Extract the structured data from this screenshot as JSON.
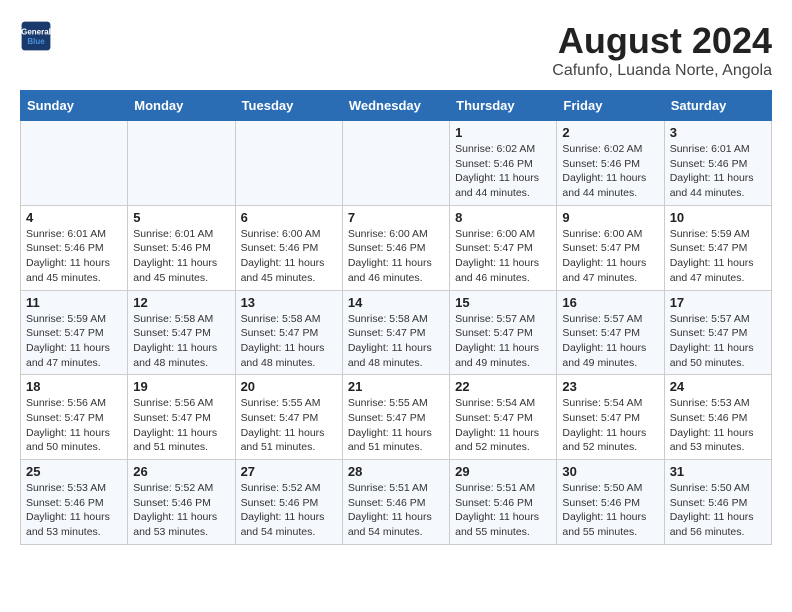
{
  "header": {
    "logo_line1": "General",
    "logo_line2": "Blue",
    "title": "August 2024",
    "subtitle": "Cafunfo, Luanda Norte, Angola"
  },
  "days_of_week": [
    "Sunday",
    "Monday",
    "Tuesday",
    "Wednesday",
    "Thursday",
    "Friday",
    "Saturday"
  ],
  "weeks": [
    [
      {
        "day": "",
        "detail": ""
      },
      {
        "day": "",
        "detail": ""
      },
      {
        "day": "",
        "detail": ""
      },
      {
        "day": "",
        "detail": ""
      },
      {
        "day": "1",
        "detail": "Sunrise: 6:02 AM\nSunset: 5:46 PM\nDaylight: 11 hours\nand 44 minutes."
      },
      {
        "day": "2",
        "detail": "Sunrise: 6:02 AM\nSunset: 5:46 PM\nDaylight: 11 hours\nand 44 minutes."
      },
      {
        "day": "3",
        "detail": "Sunrise: 6:01 AM\nSunset: 5:46 PM\nDaylight: 11 hours\nand 44 minutes."
      }
    ],
    [
      {
        "day": "4",
        "detail": "Sunrise: 6:01 AM\nSunset: 5:46 PM\nDaylight: 11 hours\nand 45 minutes."
      },
      {
        "day": "5",
        "detail": "Sunrise: 6:01 AM\nSunset: 5:46 PM\nDaylight: 11 hours\nand 45 minutes."
      },
      {
        "day": "6",
        "detail": "Sunrise: 6:00 AM\nSunset: 5:46 PM\nDaylight: 11 hours\nand 45 minutes."
      },
      {
        "day": "7",
        "detail": "Sunrise: 6:00 AM\nSunset: 5:46 PM\nDaylight: 11 hours\nand 46 minutes."
      },
      {
        "day": "8",
        "detail": "Sunrise: 6:00 AM\nSunset: 5:47 PM\nDaylight: 11 hours\nand 46 minutes."
      },
      {
        "day": "9",
        "detail": "Sunrise: 6:00 AM\nSunset: 5:47 PM\nDaylight: 11 hours\nand 47 minutes."
      },
      {
        "day": "10",
        "detail": "Sunrise: 5:59 AM\nSunset: 5:47 PM\nDaylight: 11 hours\nand 47 minutes."
      }
    ],
    [
      {
        "day": "11",
        "detail": "Sunrise: 5:59 AM\nSunset: 5:47 PM\nDaylight: 11 hours\nand 47 minutes."
      },
      {
        "day": "12",
        "detail": "Sunrise: 5:58 AM\nSunset: 5:47 PM\nDaylight: 11 hours\nand 48 minutes."
      },
      {
        "day": "13",
        "detail": "Sunrise: 5:58 AM\nSunset: 5:47 PM\nDaylight: 11 hours\nand 48 minutes."
      },
      {
        "day": "14",
        "detail": "Sunrise: 5:58 AM\nSunset: 5:47 PM\nDaylight: 11 hours\nand 48 minutes."
      },
      {
        "day": "15",
        "detail": "Sunrise: 5:57 AM\nSunset: 5:47 PM\nDaylight: 11 hours\nand 49 minutes."
      },
      {
        "day": "16",
        "detail": "Sunrise: 5:57 AM\nSunset: 5:47 PM\nDaylight: 11 hours\nand 49 minutes."
      },
      {
        "day": "17",
        "detail": "Sunrise: 5:57 AM\nSunset: 5:47 PM\nDaylight: 11 hours\nand 50 minutes."
      }
    ],
    [
      {
        "day": "18",
        "detail": "Sunrise: 5:56 AM\nSunset: 5:47 PM\nDaylight: 11 hours\nand 50 minutes."
      },
      {
        "day": "19",
        "detail": "Sunrise: 5:56 AM\nSunset: 5:47 PM\nDaylight: 11 hours\nand 51 minutes."
      },
      {
        "day": "20",
        "detail": "Sunrise: 5:55 AM\nSunset: 5:47 PM\nDaylight: 11 hours\nand 51 minutes."
      },
      {
        "day": "21",
        "detail": "Sunrise: 5:55 AM\nSunset: 5:47 PM\nDaylight: 11 hours\nand 51 minutes."
      },
      {
        "day": "22",
        "detail": "Sunrise: 5:54 AM\nSunset: 5:47 PM\nDaylight: 11 hours\nand 52 minutes."
      },
      {
        "day": "23",
        "detail": "Sunrise: 5:54 AM\nSunset: 5:47 PM\nDaylight: 11 hours\nand 52 minutes."
      },
      {
        "day": "24",
        "detail": "Sunrise: 5:53 AM\nSunset: 5:46 PM\nDaylight: 11 hours\nand 53 minutes."
      }
    ],
    [
      {
        "day": "25",
        "detail": "Sunrise: 5:53 AM\nSunset: 5:46 PM\nDaylight: 11 hours\nand 53 minutes."
      },
      {
        "day": "26",
        "detail": "Sunrise: 5:52 AM\nSunset: 5:46 PM\nDaylight: 11 hours\nand 53 minutes."
      },
      {
        "day": "27",
        "detail": "Sunrise: 5:52 AM\nSunset: 5:46 PM\nDaylight: 11 hours\nand 54 minutes."
      },
      {
        "day": "28",
        "detail": "Sunrise: 5:51 AM\nSunset: 5:46 PM\nDaylight: 11 hours\nand 54 minutes."
      },
      {
        "day": "29",
        "detail": "Sunrise: 5:51 AM\nSunset: 5:46 PM\nDaylight: 11 hours\nand 55 minutes."
      },
      {
        "day": "30",
        "detail": "Sunrise: 5:50 AM\nSunset: 5:46 PM\nDaylight: 11 hours\nand 55 minutes."
      },
      {
        "day": "31",
        "detail": "Sunrise: 5:50 AM\nSunset: 5:46 PM\nDaylight: 11 hours\nand 56 minutes."
      }
    ]
  ]
}
